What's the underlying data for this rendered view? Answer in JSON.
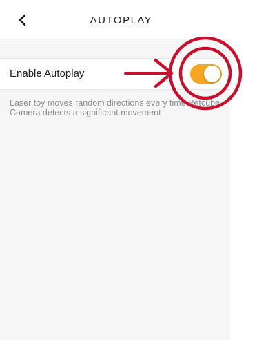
{
  "header": {
    "title": "AUTOPLAY",
    "back_icon": "chevron-left-icon"
  },
  "setting": {
    "label": "Enable Autoplay",
    "enabled": true,
    "toggle_color": "#f5a623"
  },
  "description": {
    "line1": "Laser toy moves random directions every time Petcube",
    "line2": "Camera detects a significant movement"
  },
  "annotation": {
    "color": "#c8102e",
    "shapes": [
      "arrow-icon",
      "circle-highlight-icon"
    ]
  }
}
